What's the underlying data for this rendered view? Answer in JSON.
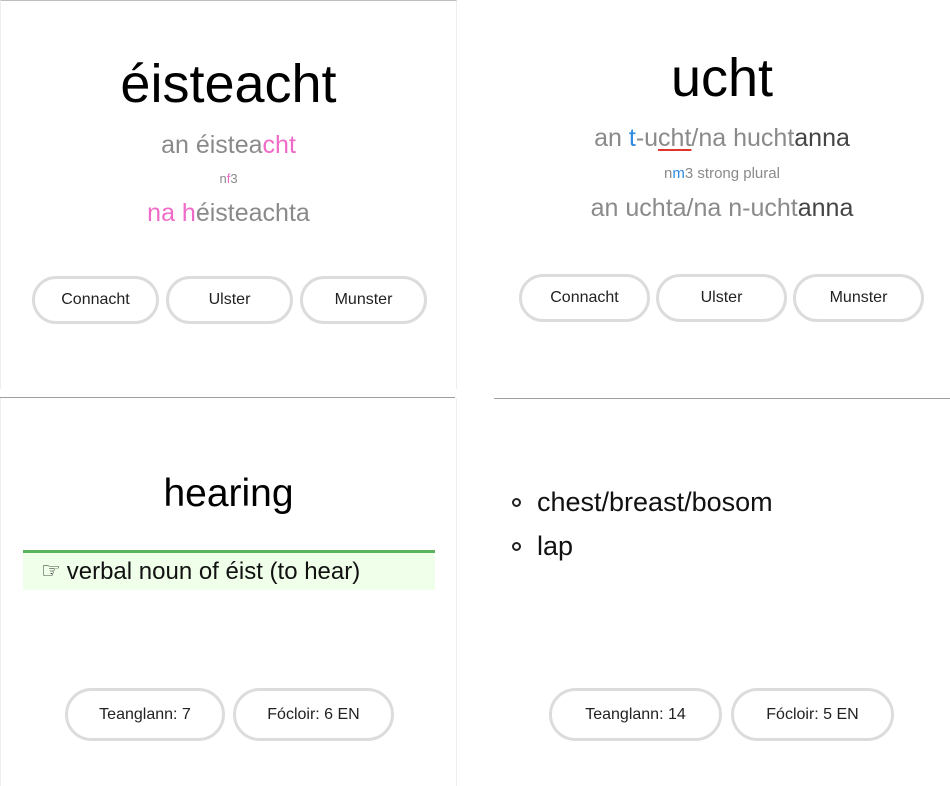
{
  "card_eisteacht": {
    "word": "éisteacht",
    "singular": {
      "p1": "an éistea",
      "p2": "cht"
    },
    "tag": {
      "p1": "n",
      "p2": "f",
      "p3": "3"
    },
    "plural": {
      "p1": "na h",
      "p2": "éisteachta"
    },
    "dialects": [
      "Connacht",
      "Ulster",
      "Munster"
    ]
  },
  "card_ucht": {
    "word": "ucht",
    "forms1": {
      "a": "an ",
      "b": "t",
      "c": "-u",
      "d": "cht",
      "e": "/na hucht",
      "f": "anna"
    },
    "tag": {
      "p1": "n",
      "p2": "m",
      "p3": "3",
      "p4": " strong plural"
    },
    "forms2": {
      "a": "an uchta/na n-ucht",
      "b": "anna"
    },
    "dialects": [
      "Connacht",
      "Ulster",
      "Munster"
    ]
  },
  "card_hearing": {
    "translation": "hearing",
    "note": "verbal noun of éist (to hear)",
    "hand_icon": "☞",
    "teanglann": "Teanglann: 7",
    "focloir": "Fócloir: 6 EN"
  },
  "card_chest": {
    "definitions": [
      "chest/breast/bosom",
      "lap"
    ],
    "teanglann": "Teanglann: 14",
    "focloir": "Fócloir: 5 EN"
  },
  "colors": {
    "pink": "#f06ac8",
    "blue": "#2e8be0",
    "grey": "#8a8a8a",
    "green_note_bg": "#efffea",
    "green_note_border": "#5bb35b"
  }
}
